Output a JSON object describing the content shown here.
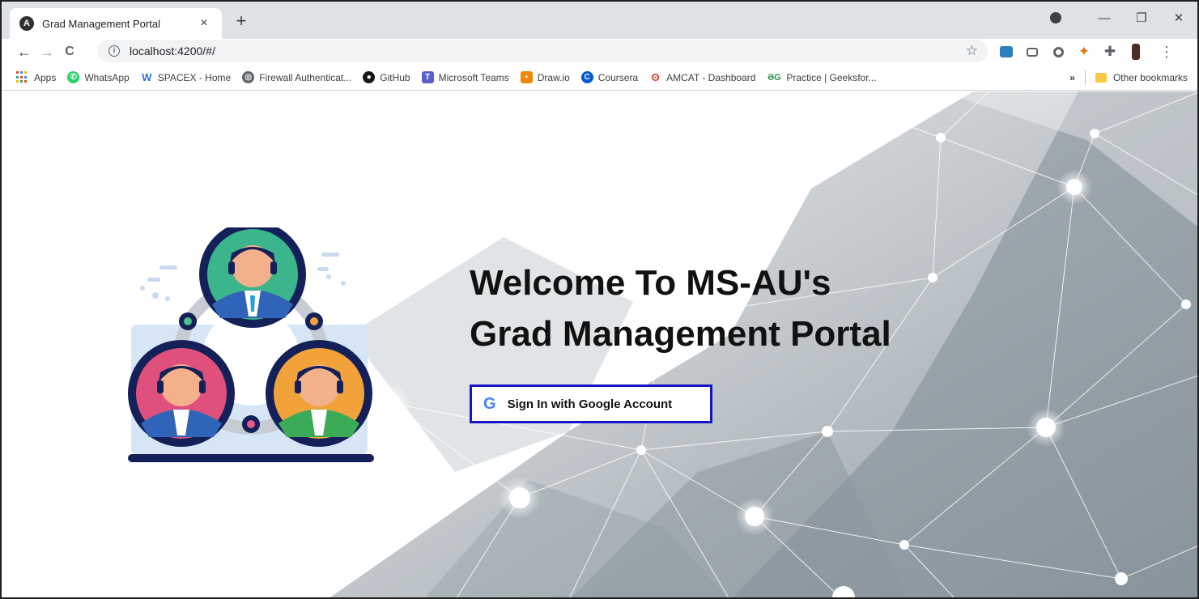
{
  "tab": {
    "title": "Grad Management Portal",
    "favicon_letter": "A",
    "close_glyph": "×",
    "new_tab_glyph": "+"
  },
  "window_controls": {
    "minimize": "—",
    "restore": "❐",
    "close": "✕"
  },
  "toolbar": {
    "back": "←",
    "forward": "→",
    "reload": "C",
    "info": "i",
    "url": "localhost:4200/#/",
    "star": "☆",
    "menu": "⋮"
  },
  "bookmarks": {
    "items": [
      {
        "label": "Apps",
        "icon": "apps-grid-icon"
      },
      {
        "label": "WhatsApp",
        "icon": "whatsapp-icon",
        "color": "#25d366"
      },
      {
        "label": "SPACEX - Home",
        "icon": "spacex-icon",
        "color": "#2e6fd8"
      },
      {
        "label": "Firewall Authenticat...",
        "icon": "globe-icon",
        "color": "#5f6368"
      },
      {
        "label": "GitHub",
        "icon": "github-icon",
        "color": "#181717"
      },
      {
        "label": "Microsoft Teams",
        "icon": "teams-icon",
        "color": "#5b5fc7"
      },
      {
        "label": "Draw.io",
        "icon": "drawio-icon",
        "color": "#f08705"
      },
      {
        "label": "Coursera",
        "icon": "coursera-icon",
        "color": "#0056d2"
      },
      {
        "label": "AMCAT - Dashboard",
        "icon": "amcat-icon",
        "color": "#d9392b"
      },
      {
        "label": "Practice | Geeksfor...",
        "icon": "geeksforgeeks-icon",
        "color": "#2f8d46"
      }
    ],
    "overflow": "»",
    "other": "Other bookmarks"
  },
  "page": {
    "headline_line1": "Welcome To MS-AU's",
    "headline_line2": "Grad Management Portal",
    "signin_label": "Sign In with Google Account",
    "google_letter": "G"
  }
}
